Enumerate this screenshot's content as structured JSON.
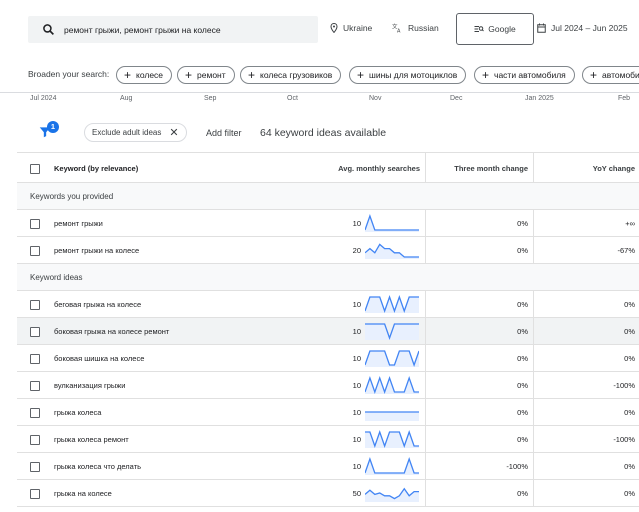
{
  "search": {
    "query": "ремонт грыжи, ремонт грыжи на колесе",
    "location": "Ukraine",
    "language": "Russian",
    "network": "Google",
    "date_range": "Jul 2024 – Jun 2025"
  },
  "broaden": {
    "label": "Broaden your search:",
    "chips": [
      "колесе",
      "ремонт",
      "колеса грузовиков",
      "шины для мотоциклов",
      "части автомобиля",
      "автомоби"
    ]
  },
  "timeline": {
    "labels": [
      "Jul 2024",
      "Aug",
      "Sep",
      "Oct",
      "Nov",
      "Dec",
      "Jan 2025",
      "Feb"
    ]
  },
  "filters": {
    "badge_count": "1",
    "exclude_chip": "Exclude adult ideas",
    "add_filter": "Add filter",
    "ideas_count": "64 keyword ideas available"
  },
  "table": {
    "headers": {
      "keyword": "Keyword (by relevance)",
      "avg": "Avg. monthly searches",
      "three": "Three month change",
      "yoy": "YoY change"
    },
    "group_provided": "Keywords you provided",
    "group_ideas": "Keyword ideas",
    "provided": [
      {
        "keyword": "ремонт грыжи",
        "avg": "10",
        "three": "0%",
        "yoy": "+∞",
        "trend": [
          0,
          1,
          0,
          0,
          0,
          0,
          0,
          0,
          0,
          0,
          0,
          0
        ]
      },
      {
        "keyword": "ремонт грыжи на колесе",
        "avg": "20",
        "three": "0%",
        "yoy": "-67%",
        "trend": [
          0.3,
          0.6,
          0.3,
          0.9,
          0.6,
          0.6,
          0.3,
          0.3,
          0,
          0,
          0,
          0
        ]
      }
    ],
    "ideas": [
      {
        "keyword": "беговая грыжа на колесе",
        "avg": "10",
        "three": "0%",
        "yoy": "0%",
        "trend": [
          0,
          1,
          1,
          1,
          0,
          1,
          0,
          1,
          0,
          1,
          1,
          1
        ]
      },
      {
        "keyword": "боковая грыжа на колесе ремонт",
        "avg": "10",
        "three": "0%",
        "yoy": "0%",
        "trend": [
          1,
          1,
          1,
          1,
          1,
          0,
          1,
          1,
          1,
          1,
          1,
          1
        ]
      },
      {
        "keyword": "боковая шишка на колесе",
        "avg": "10",
        "three": "0%",
        "yoy": "0%",
        "trend": [
          0,
          1,
          1,
          1,
          1,
          0,
          0,
          1,
          1,
          1,
          0,
          1
        ]
      },
      {
        "keyword": "вулканизация грыжи",
        "avg": "10",
        "three": "0%",
        "yoy": "-100%",
        "trend": [
          0,
          1,
          0,
          1,
          0,
          1,
          0,
          0,
          0,
          1,
          0,
          0
        ]
      },
      {
        "keyword": "грыжа колеса",
        "avg": "10",
        "three": "0%",
        "yoy": "0%",
        "trend": [
          0.5,
          0.5,
          0.5,
          0.5,
          0.5,
          0.5,
          0.5,
          0.5,
          0.5,
          0.5,
          0.5,
          0.5
        ]
      },
      {
        "keyword": "грыжа колеса ремонт",
        "avg": "10",
        "three": "0%",
        "yoy": "-100%",
        "trend": [
          1,
          1,
          0,
          1,
          0,
          1,
          1,
          1,
          0,
          1,
          0,
          0
        ]
      },
      {
        "keyword": "грыжа колеса что делать",
        "avg": "10",
        "three": "-100%",
        "yoy": "0%",
        "trend": [
          0,
          1,
          0,
          0,
          0,
          0,
          0,
          0,
          0,
          1,
          0,
          0
        ]
      },
      {
        "keyword": "грыжа на колесе",
        "avg": "50",
        "three": "0%",
        "yoy": "0%",
        "trend": [
          0.4,
          0.7,
          0.4,
          0.5,
          0.3,
          0.3,
          0.1,
          0.3,
          0.8,
          0.3,
          0.6,
          0.6
        ]
      }
    ]
  },
  "colors": {
    "accent": "#1a73e8",
    "spark_line": "#4285f4",
    "spark_fill": "#e8f0fe"
  }
}
